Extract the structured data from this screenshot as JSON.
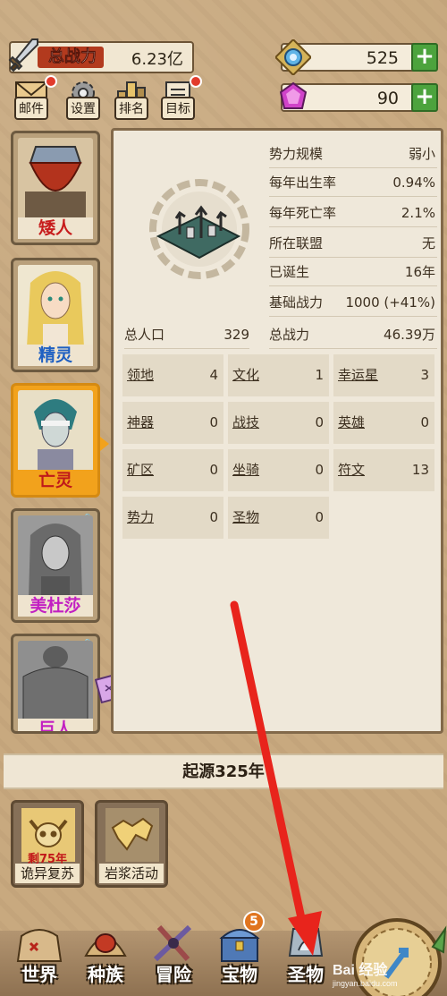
{
  "top": {
    "power_label": "总战力",
    "power_value": "6.23亿",
    "gem_value": "525",
    "crystal_value": "90",
    "plus": "+",
    "icons": [
      {
        "label": "邮件",
        "icon": "mail-icon"
      },
      {
        "label": "设置",
        "icon": "gear-icon"
      },
      {
        "label": "排名",
        "icon": "ranking-icon"
      },
      {
        "label": "目标",
        "icon": "goal-icon"
      }
    ]
  },
  "races": [
    {
      "name": "矮人",
      "color": "#c71d1d",
      "locked": false,
      "selected": false
    },
    {
      "name": "精灵",
      "color": "#1e5fc2",
      "locked": false,
      "selected": false
    },
    {
      "name": "亡灵",
      "color": "#c01a1a",
      "locked": false,
      "selected": true
    },
    {
      "name": "美杜莎",
      "color": "#c21fc2",
      "locked": true,
      "selected": false
    },
    {
      "name": "巨人",
      "color": "#c21fc2",
      "locked": true,
      "selected": false
    }
  ],
  "info": {
    "stats": [
      {
        "label": "势力规模",
        "value": "弱小"
      },
      {
        "label": "每年出生率",
        "value": "0.94%"
      },
      {
        "label": "每年死亡率",
        "value": "2.1%"
      },
      {
        "label": "所在联盟",
        "value": "无"
      },
      {
        "label": "已诞生",
        "value": "16年"
      },
      {
        "label": "基础战力",
        "value": "1000 (+41%)"
      },
      {
        "label": "总战力",
        "value": "46.39万"
      }
    ],
    "population": {
      "label": "总人口",
      "value": "329"
    },
    "grid": [
      {
        "label": "领地",
        "value": "4"
      },
      {
        "label": "文化",
        "value": "1"
      },
      {
        "label": "幸运星",
        "value": "3"
      },
      {
        "label": "神器",
        "value": "0"
      },
      {
        "label": "战技",
        "value": "0"
      },
      {
        "label": "英雄",
        "value": "0"
      },
      {
        "label": "矿区",
        "value": "0"
      },
      {
        "label": "坐骑",
        "value": "0"
      },
      {
        "label": "符文",
        "value": "13"
      },
      {
        "label": "势力",
        "value": "0"
      },
      {
        "label": "圣物",
        "value": "0"
      }
    ]
  },
  "epoch": {
    "title": "起源325年"
  },
  "events": [
    {
      "label": "诡异复苏",
      "sub": "剩75年"
    },
    {
      "label": "岩浆活动",
      "sub": ""
    }
  ],
  "nav": [
    {
      "label": "世界",
      "icon": "world-icon"
    },
    {
      "label": "种族",
      "icon": "race-icon"
    },
    {
      "label": "冒险",
      "icon": "adventure-icon"
    },
    {
      "label": "宝物",
      "icon": "treasure-icon",
      "badge": "5"
    },
    {
      "label": "圣物",
      "icon": "relic-icon"
    }
  ],
  "watermark": {
    "main": "Bai 经验",
    "sub": "jingyan.baidu.com"
  },
  "colors": {
    "accent": "#f2a21c",
    "plus": "#4ca33d",
    "panel": "#efe8da",
    "annotation": "#e8241c"
  }
}
